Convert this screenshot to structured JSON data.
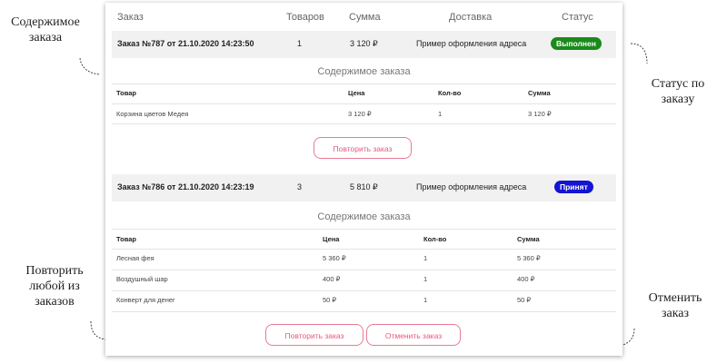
{
  "annotations": {
    "contents": "Содержимое заказа",
    "status": "Статус по заказу",
    "repeat": "Повторить любой из заказов",
    "cancel": "Отменить заказ"
  },
  "headers": {
    "order": "Заказ",
    "items": "Товаров",
    "sum": "Сумма",
    "delivery": "Доставка",
    "status": "Статус"
  },
  "colors": {
    "status_done": "#1a8a1a",
    "status_accepted": "#1414d2",
    "button_accent": "#e65a7d"
  },
  "orders": [
    {
      "title": "Заказ №787 от 21.10.2020 14:23:50",
      "count": "1",
      "sum": "3 120 ₽",
      "delivery": "Пример оформления адреса",
      "status": "Выполнен",
      "contents_title": "Содержимое заказа",
      "columns": [
        "Товар",
        "Цена",
        "Кол-во",
        "Сумма"
      ],
      "rows": [
        [
          "Корзина цветов Медея",
          "3 120 ₽",
          "1",
          "3 120 ₽"
        ]
      ],
      "repeat_label": "Повторить заказ"
    },
    {
      "title": "Заказ №786 от 21.10.2020 14:23:19",
      "count": "3",
      "sum": "5 810 ₽",
      "delivery": "Пример оформления адреса",
      "status": "Принят",
      "contents_title": "Содержимое заказа",
      "columns": [
        "Товар",
        "Цена",
        "Кол-во",
        "Сумма"
      ],
      "rows": [
        [
          "Лесная фея",
          "5 360 ₽",
          "1",
          "5 360 ₽"
        ],
        [
          "Воздушный шар",
          "400 ₽",
          "1",
          "400 ₽"
        ],
        [
          "Конверт для денег",
          "50 ₽",
          "1",
          "50 ₽"
        ]
      ],
      "repeat_label": "Повторить заказ",
      "cancel_label": "Отменить заказ"
    }
  ]
}
